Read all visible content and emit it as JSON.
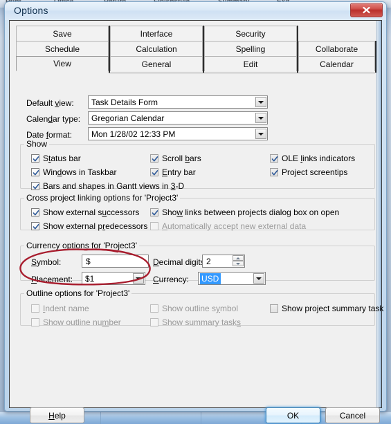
{
  "background": {
    "menu_items": [
      "Print",
      "Office",
      "Return",
      "Finishstyle",
      "Summary",
      "Exit"
    ]
  },
  "window": {
    "title": "Options",
    "close_label": "Close"
  },
  "tabs": {
    "columns": [
      [
        "Save",
        "Schedule",
        "View"
      ],
      [
        "Interface",
        "Calculation",
        "General"
      ],
      [
        "Security",
        "Spelling",
        "Edit"
      ],
      [
        "",
        "Collaborate",
        "Calendar"
      ]
    ],
    "active": "View"
  },
  "general": {
    "default_view": {
      "label_pre": "Default ",
      "label_accel": "v",
      "label_post": "iew:",
      "value": "Task Details Form"
    },
    "calendar_type": {
      "label_pre": "Calen",
      "label_accel": "d",
      "label_post": "ar type:",
      "value": "Gregorian Calendar"
    },
    "date_format": {
      "label_pre": "Date ",
      "label_accel": "f",
      "label_post": "ormat:",
      "value": "Mon 1/28/02 12:33 PM"
    }
  },
  "show_group": {
    "title": "Show",
    "items": [
      {
        "pre": "S",
        "accel": "t",
        "post": "atus bar",
        "checked": true,
        "enabled": true
      },
      {
        "pre": "Win",
        "accel": "d",
        "post": "ows in Taskbar",
        "checked": true,
        "enabled": true
      },
      {
        "pre": "Bars and shapes in Gantt views in ",
        "accel": "3",
        "post": "-D",
        "checked": true,
        "enabled": true
      },
      {
        "pre": "Scroll ",
        "accel": "b",
        "post": "ars",
        "checked": true,
        "enabled": true
      },
      {
        "pre": "",
        "accel": "E",
        "post": "ntry bar",
        "checked": true,
        "enabled": true
      },
      {
        "pre": "OLE ",
        "accel": "l",
        "post": "inks indicators",
        "checked": true,
        "enabled": true
      },
      {
        "pre": "Project screentips",
        "accel": "",
        "post": "",
        "checked": true,
        "enabled": true
      }
    ]
  },
  "cross_project_group": {
    "title": "Cross project linking options for 'Project3'",
    "items": [
      {
        "pre": "Show external s",
        "accel": "u",
        "post": "ccessors",
        "checked": true,
        "enabled": true
      },
      {
        "pre": "Show external p",
        "accel": "r",
        "post": "edecessors",
        "checked": true,
        "enabled": true
      },
      {
        "pre": "Sho",
        "accel": "w",
        "post": " links between projects dialog box on open",
        "checked": true,
        "enabled": true
      },
      {
        "pre": "",
        "accel": "A",
        "post": "utomatically accept new external data",
        "checked": false,
        "enabled": false
      }
    ]
  },
  "currency_group": {
    "title": "Currency options for 'Project3'",
    "symbol": {
      "label_pre": "",
      "label_accel": "S",
      "label_post": "ymbol:",
      "value": "$"
    },
    "decimal_digits": {
      "label_pre": "",
      "label_accel": "D",
      "label_post": "ecimal digits:",
      "value": "2"
    },
    "placement": {
      "label_pre": "",
      "label_accel": "P",
      "label_post": "lacement:",
      "value": "$1"
    },
    "currency": {
      "label_pre": "",
      "label_accel": "C",
      "label_post": "urrency:",
      "value": "USD",
      "selected": true
    }
  },
  "outline_group": {
    "title": "Outline options for 'Project3'",
    "items": [
      {
        "pre": "",
        "accel": "I",
        "post": "ndent name",
        "checked": false,
        "enabled": false
      },
      {
        "pre": "Show outline nu",
        "accel": "m",
        "post": "ber",
        "checked": false,
        "enabled": false
      },
      {
        "pre": "Show outline s",
        "accel": "y",
        "post": "mbol",
        "checked": false,
        "enabled": false
      },
      {
        "pre": "Show summary task",
        "accel": "s",
        "post": "",
        "checked": false,
        "enabled": false
      },
      {
        "pre": "Show pro",
        "accel": "j",
        "post": "ect summary task",
        "checked": false,
        "enabled": true
      }
    ]
  },
  "footer": {
    "help": {
      "pre": "",
      "accel": "H",
      "post": "elp"
    },
    "ok": "OK",
    "cancel": "Cancel"
  },
  "annotation": {
    "type": "hand-drawn-ellipse",
    "color": "#a81d2e",
    "targets": "Symbol field"
  }
}
